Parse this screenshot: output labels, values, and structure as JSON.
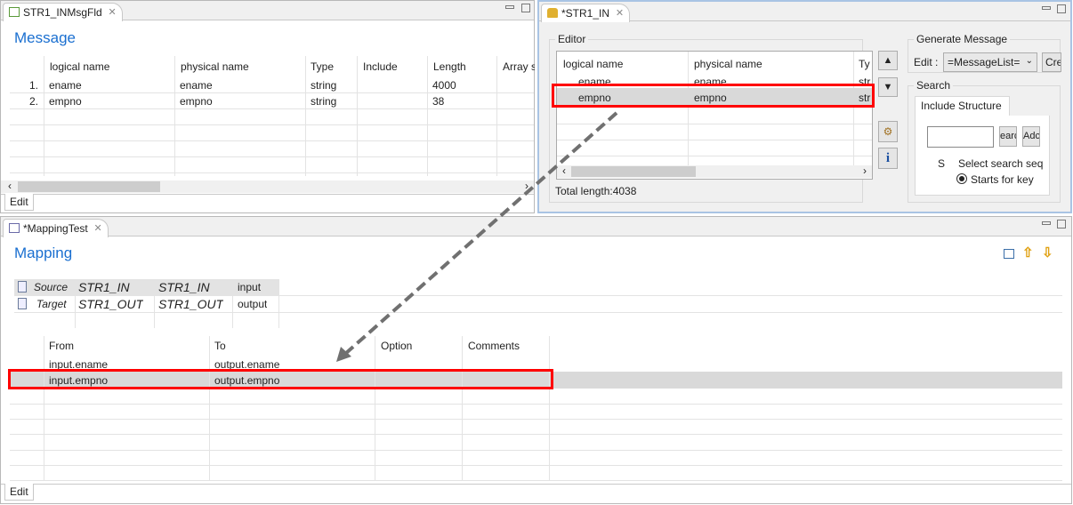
{
  "message_panel": {
    "tab": "STR1_INMsgFld",
    "title": "Message",
    "columns": [
      "logical name",
      "physical name",
      "Type",
      "Include",
      "Length",
      "Array s"
    ],
    "rows": [
      {
        "num": "1.",
        "logical": "ename",
        "physical": "ename",
        "type": "string",
        "include": "",
        "length": "4000"
      },
      {
        "num": "2.",
        "logical": "empno",
        "physical": "empno",
        "type": "string",
        "include": "",
        "length": "38"
      }
    ],
    "edit_tab": "Edit"
  },
  "editor_panel": {
    "tab": "*STR1_IN",
    "group": "Editor",
    "columns": [
      "logical name",
      "physical name",
      "Ty"
    ],
    "rows": [
      {
        "logical": "ename",
        "physical": "ename",
        "type": "str"
      },
      {
        "logical": "empno",
        "physical": "empno",
        "type": "str",
        "selected": true
      }
    ],
    "total_length": "Total length:4038",
    "generate": {
      "label": "Generate Message",
      "edit_label": "Edit :",
      "combo_value": "=MessageList=",
      "create_button": "Cre"
    },
    "search": {
      "label": "Search",
      "tab": "Include Structure",
      "search_button": "earc",
      "add_button": "Adc",
      "s_label": "S",
      "seq_label": "Select search seq",
      "radio_label": "Starts for key"
    }
  },
  "mapping_panel": {
    "tab": "*MappingTest",
    "title": "Mapping",
    "io": [
      {
        "kind": "Source",
        "name": "STR1_IN",
        "physical": "STR1_IN",
        "var": "input"
      },
      {
        "kind": "Target",
        "name": "STR1_OUT",
        "physical": "STR1_OUT",
        "var": "output"
      }
    ],
    "columns": [
      "From",
      "To",
      "Option",
      "Comments"
    ],
    "rows": [
      {
        "from": "input.ename",
        "to": "output.ename"
      },
      {
        "from": "input.empno",
        "to": "output.empno",
        "selected": true
      }
    ],
    "edit_tab": "Edit"
  },
  "colors": {
    "title": "#1a6fd0",
    "highlight": "#ff0000",
    "selected_row": "#d9d9d9"
  }
}
